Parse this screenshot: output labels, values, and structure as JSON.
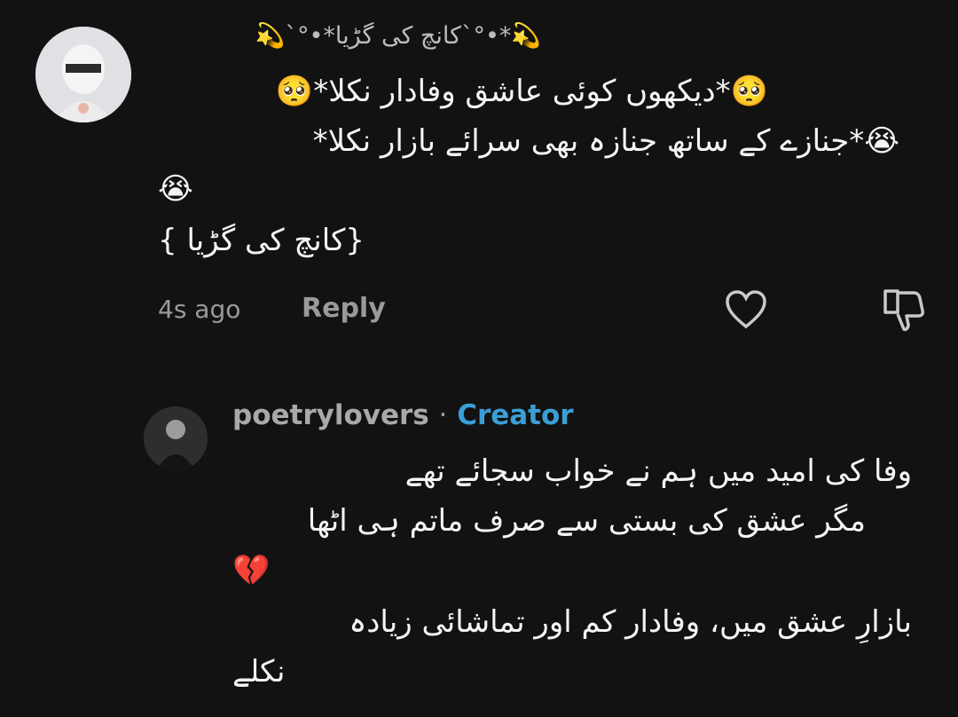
{
  "comment1": {
    "username": "💫*•°`کانچ کی گڑیا*•°`💫",
    "lines": [
      "🥺*دیکھوں کوئی عاشق وفادار نکلا*🥺",
      "😭*جنازے کے ساتھ جنازہ بھی سرائے بازار نکلا*",
      "😭",
      "{کانچ کی گڑیا }"
    ],
    "time": "4s ago",
    "reply_label": "Reply"
  },
  "comment2": {
    "username": "poetrylovers",
    "separator": "·",
    "badge": "Creator",
    "lines": [
      "وفا کی امید میں ہم نے خواب سجائے تھے",
      "مگر عشق کی بستی سے صرف ماتم ہی اٹھا",
      "💔",
      "بازارِ عشق میں، وفادار کم اور تماشائی زیادہ",
      "نکلے"
    ]
  },
  "colors": {
    "background": "#121212",
    "creator_badge": "#3a9fd6",
    "muted_text": "#9a9a9a"
  }
}
